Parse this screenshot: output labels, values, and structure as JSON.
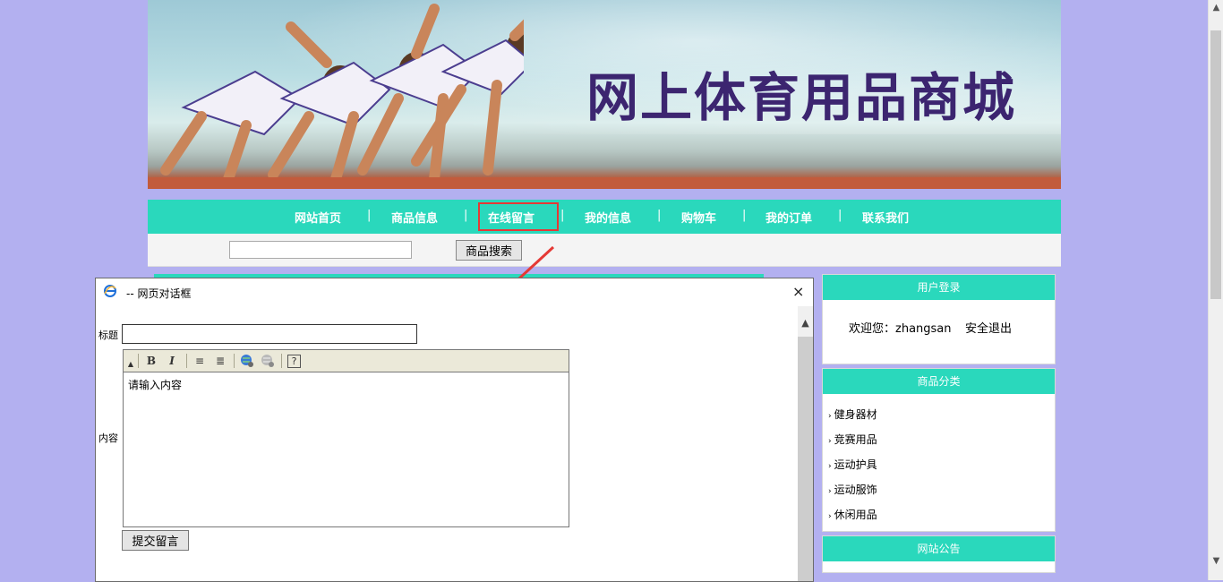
{
  "site": {
    "title": "网上体育用品商城",
    "nav": {
      "items": [
        "网站首页",
        "商品信息",
        "在线留言",
        "我的信息",
        "购物车",
        "我的订单",
        "联系我们"
      ],
      "separator": "|",
      "active": "在线留言"
    },
    "search": {
      "value": "",
      "button_label": "商品搜索"
    }
  },
  "sidebar": {
    "login": {
      "header": "用户登录",
      "welcome": "欢迎您：zhangsan",
      "logout": "安全退出"
    },
    "categories": {
      "header": "商品分类",
      "items": [
        "健身器材",
        "竞赛用品",
        "运动护具",
        "运动服饰",
        "休闲用品"
      ]
    },
    "notice": {
      "header": "网站公告"
    }
  },
  "dialog": {
    "title": "-- 网页对话框",
    "close_glyph": "×",
    "title_label": "标题",
    "title_value": "",
    "content_label": "内容",
    "editor_placeholder": "请输入内容",
    "toolbar": {
      "bold": "B",
      "italic": "I",
      "ordered_list": "≡",
      "unordered_list": "≣",
      "help": "?"
    },
    "submit_label": "提交留言"
  },
  "colors": {
    "accent": "#2ad8bc",
    "background": "#b3b0f0",
    "brand_text": "#3c2570",
    "highlight": "#e53935"
  }
}
